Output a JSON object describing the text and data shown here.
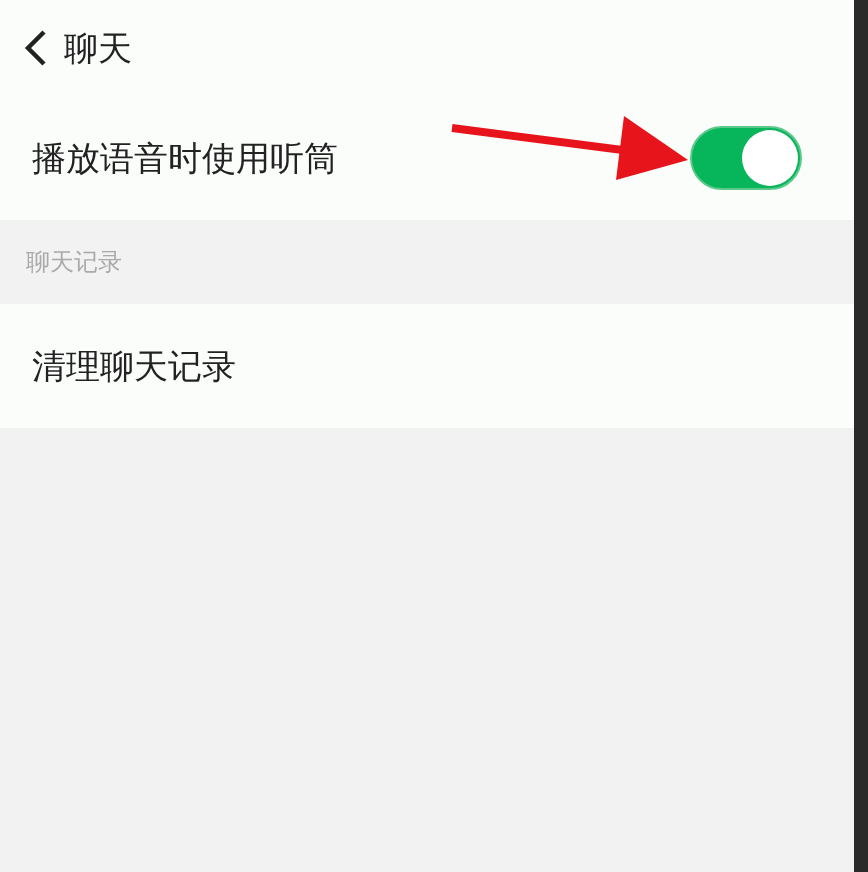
{
  "header": {
    "title": "聊天"
  },
  "items": [
    {
      "kind": "toggle",
      "label": "播放语音时使用听筒",
      "on": true
    },
    {
      "kind": "section",
      "label": "聊天记录"
    },
    {
      "kind": "link",
      "label": "清理聊天记录"
    }
  ]
}
